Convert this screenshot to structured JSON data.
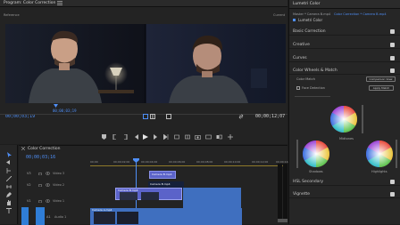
{
  "program": {
    "title": "Program: Color Correction",
    "menu_icon": "hamburger-icon",
    "subhead_left": "Reference",
    "subhead_right": "Current",
    "timecode_current": "00;00;03;19",
    "timecode_mid": "00;00;03;19",
    "zoom": "Fit",
    "timecode_total": "00;00;12;07"
  },
  "timeline": {
    "sequence_name": "Color Correction",
    "timecode": "00;00;03;16",
    "ruler": [
      "00;00",
      "00;00;02;00",
      "00;00;04;00",
      "00;00;06;00",
      "00;00;08;00",
      "00;00;10;00",
      "00;00;12;00",
      "00;00;14;00"
    ],
    "tracks": [
      {
        "name": "V3",
        "label": "Video 3"
      },
      {
        "name": "V2",
        "label": "Video 2"
      },
      {
        "name": "V1",
        "label": "Video 1"
      },
      {
        "name": "A1",
        "label": "Audio 1"
      }
    ],
    "clips": [
      {
        "label": "Camera B.mp4",
        "color": "#5b63c9"
      },
      {
        "label": "Camera B.mp4",
        "color": "#5b63c9"
      },
      {
        "label": "Camera B.mp4",
        "color": "#5b63c9"
      },
      {
        "label": "Camera A.mp4",
        "color": "#3f6fbf"
      }
    ]
  },
  "lumetri": {
    "title": "Lumetri Color",
    "breadcrumb_left": "Master * Camera B.mp4",
    "breadcrumb_right": "Color Correction * Camera B.mp4",
    "effect": "Lumetri Color",
    "sections": [
      {
        "label": "Basic Correction"
      },
      {
        "label": "Creative"
      },
      {
        "label": "Curves"
      },
      {
        "label": "Color Wheels & Match"
      },
      {
        "label": "HSL Secondary"
      },
      {
        "label": "Vignette"
      }
    ],
    "color_match_label": "Color Match",
    "comparison_view_label": "Comparison View",
    "face_detection_label": "Face Detection",
    "apply_match_label": "Apply Match",
    "midtones_label": "Midtones",
    "shadows_label": "Shadows",
    "highlights_label": "Highlights"
  },
  "colors": {
    "accent": "#4f8ff7",
    "clip": "#5b63c9",
    "audio": "#2f7dd6"
  }
}
